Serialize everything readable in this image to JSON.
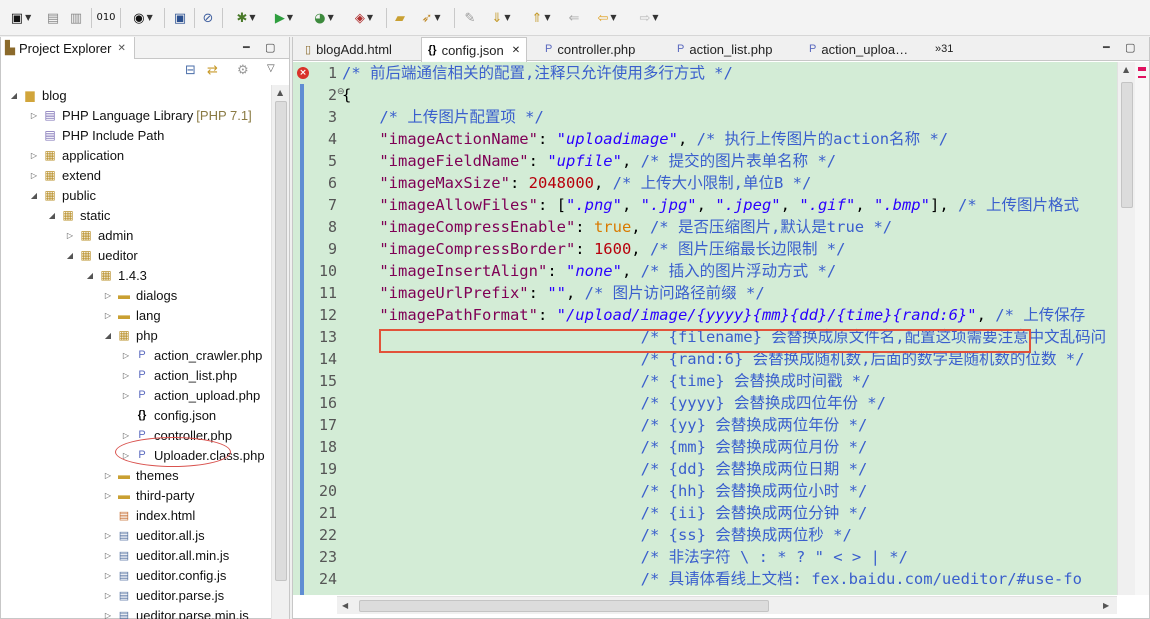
{
  "toolbar": {
    "icons": [
      "new-icon",
      "save-icon",
      "save-all-icon",
      "binary-icon",
      "person-icon",
      "console-icon",
      "skip-breakpoints-icon",
      "debug-icon",
      "run-icon",
      "coverage-icon",
      "external-tools-icon",
      "open-type-icon",
      "open-task-icon",
      "annotation-icon",
      "next-annotation-icon",
      "prev-annotation-icon",
      "last-edit-icon",
      "back-icon",
      "forward-icon"
    ]
  },
  "explorer": {
    "title": "Project Explorer",
    "tree": [
      {
        "label": "blog",
        "icon": "project"
      },
      {
        "label": "PHP Language Library",
        "decoration": "[PHP 7.1]",
        "icon": "library"
      },
      {
        "label": "PHP Include Path",
        "icon": "library"
      },
      {
        "label": "application",
        "icon": "folder"
      },
      {
        "label": "extend",
        "icon": "folder"
      },
      {
        "label": "public",
        "icon": "folder"
      },
      {
        "label": "static",
        "icon": "folder"
      },
      {
        "label": "admin",
        "icon": "folder"
      },
      {
        "label": "ueditor",
        "icon": "folder"
      },
      {
        "label": "1.4.3",
        "icon": "folder"
      },
      {
        "label": "dialogs",
        "icon": "folder"
      },
      {
        "label": "lang",
        "icon": "folder"
      },
      {
        "label": "php",
        "icon": "folder"
      },
      {
        "label": "action_crawler.php",
        "icon": "php"
      },
      {
        "label": "action_list.php",
        "icon": "php"
      },
      {
        "label": "action_upload.php",
        "icon": "php"
      },
      {
        "label": "config.json",
        "icon": "json"
      },
      {
        "label": "controller.php",
        "icon": "php"
      },
      {
        "label": "Uploader.class.php",
        "icon": "php"
      },
      {
        "label": "themes",
        "icon": "folder"
      },
      {
        "label": "third-party",
        "icon": "folder"
      },
      {
        "label": "index.html",
        "icon": "html"
      },
      {
        "label": "ueditor.all.js",
        "icon": "js"
      },
      {
        "label": "ueditor.all.min.js",
        "icon": "js"
      },
      {
        "label": "ueditor.config.js",
        "icon": "js"
      },
      {
        "label": "ueditor.parse.js",
        "icon": "js"
      },
      {
        "label": "ueditor.parse.min.js",
        "icon": "js"
      }
    ]
  },
  "editor": {
    "tabs": [
      "blogAdd.html",
      "config.json",
      "controller.php",
      "action_list.php",
      "action_uploa…"
    ],
    "overflow_count": "»31",
    "active_tab": "config.json",
    "line_numbers": [
      "1",
      "2",
      "3",
      "4",
      "5",
      "6",
      "7",
      "8",
      "9",
      "10",
      "11",
      "12",
      "13",
      "14",
      "15",
      "16",
      "17",
      "18",
      "19",
      "20",
      "21",
      "22",
      "23",
      "24"
    ],
    "lines": [
      "/* 前后端通信相关的配置,注释只允许使用多行方式 */",
      "{",
      "    /* 上传图片配置项 */",
      "    \"imageActionName\": \"uploadimage\", /* 执行上传图片的action名称 */",
      "    \"imageFieldName\": \"upfile\", /* 提交的图片表单名称 */",
      "    \"imageMaxSize\": 2048000, /* 上传大小限制,单位B */",
      "    \"imageAllowFiles\": [\".png\", \".jpg\", \".jpeg\", \".gif\", \".bmp\"], /* 上传图片格式",
      "    \"imageCompressEnable\": true, /* 是否压缩图片,默认是true */",
      "    \"imageCompressBorder\": 1600, /* 图片压缩最长边限制 */",
      "    \"imageInsertAlign\": \"none\", /* 插入的图片浮动方式 */",
      "    \"imageUrlPrefix\": \"\", /* 图片访问路径前缀 */",
      "    \"imagePathFormat\": \"/upload/image/{yyyy}{mm}{dd}/{time}{rand:6}\", /* 上传保存",
      "                                /* {filename} 会替换成原文件名,配置这项需要注意中文乱码问",
      "                                /* {rand:6} 会替换成随机数,后面的数字是随机数的位数 */",
      "                                /* {time} 会替换成时间戳 */",
      "                                /* {yyyy} 会替换成四位年份 */",
      "                                /* {yy} 会替换成两位年份 */",
      "                                /* {mm} 会替换成两位月份 */",
      "                                /* {dd} 会替换成两位日期 */",
      "                                /* {hh} 会替换成两位小时 */",
      "                                /* {ii} 会替换成两位分钟 */",
      "                                /* {ss} 会替换成两位秒 */",
      "                                /* 非法字符 \\ : * ? \" < > | */",
      "                                /* 具请体看线上文档: fex.baidu.com/ueditor/#use-fo"
    ]
  }
}
